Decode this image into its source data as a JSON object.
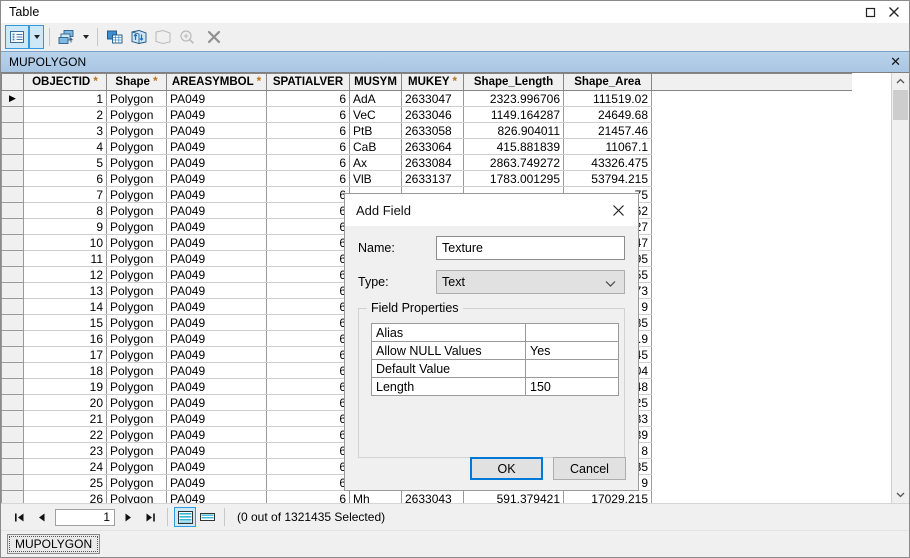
{
  "window": {
    "title": "Table",
    "restore_icon": "restore-window-icon",
    "close_icon": "close-window-icon"
  },
  "toolbar": {
    "items": [
      {
        "name": "table-options-button",
        "icon": "table-options-icon"
      },
      {
        "name": "table-options-dropdown",
        "icon": "chevron-down-icon"
      },
      {
        "name": "related-tables-button",
        "icon": "related-tables-icon"
      },
      {
        "name": "related-tables-dropdown",
        "icon": "chevron-down-icon"
      },
      {
        "name": "select-by-attributes-button",
        "icon": "select-by-attributes-icon"
      },
      {
        "name": "switch-selection-button",
        "icon": "switch-selection-icon"
      },
      {
        "name": "zoom-to-selected-button",
        "icon": "zoom-to-selected-icon"
      },
      {
        "name": "zoom-to-selection-button",
        "icon": "magnifier-plus-icon"
      },
      {
        "name": "clear-selection-button",
        "icon": "clear-selection-x-icon"
      }
    ]
  },
  "tabstrip": {
    "label": "MUPOLYGON",
    "close_icon": "close-tab-icon"
  },
  "table": {
    "columns": [
      {
        "label": "OBJECTID",
        "required": true,
        "align": "num",
        "cls": "col-oid"
      },
      {
        "label": "Shape",
        "required": true,
        "align": "txt",
        "cls": "col-shape"
      },
      {
        "label": "AREASYMBOL",
        "required": true,
        "align": "txt",
        "cls": "col-area"
      },
      {
        "label": "SPATIALVER",
        "required": false,
        "align": "num",
        "cls": "col-spat"
      },
      {
        "label": "MUSYM",
        "required": false,
        "align": "txt",
        "cls": "col-musym"
      },
      {
        "label": "MUKEY",
        "required": true,
        "align": "txt",
        "cls": "col-mukey"
      },
      {
        "label": "Shape_Length",
        "required": false,
        "align": "num",
        "cls": "col-len"
      },
      {
        "label": "Shape_Area",
        "required": false,
        "align": "num",
        "cls": "col-sarea"
      }
    ],
    "rows": [
      [
        "1",
        "Polygon",
        "PA049",
        "6",
        "AdA",
        "2633047",
        "2323.996706",
        "111519.02"
      ],
      [
        "2",
        "Polygon",
        "PA049",
        "6",
        "VeC",
        "2633046",
        "1149.164287",
        "24649.68"
      ],
      [
        "3",
        "Polygon",
        "PA049",
        "6",
        "PtB",
        "2633058",
        "826.904011",
        "21457.46"
      ],
      [
        "4",
        "Polygon",
        "PA049",
        "6",
        "CaB",
        "2633064",
        "415.881839",
        "11067.1"
      ],
      [
        "5",
        "Polygon",
        "PA049",
        "6",
        "Ax",
        "2633084",
        "2863.749272",
        "43326.475"
      ],
      [
        "6",
        "Polygon",
        "PA049",
        "6",
        "VlB",
        "2633137",
        "1783.001295",
        "53794.215"
      ],
      [
        "7",
        "Polygon",
        "PA049",
        "6",
        "",
        "",
        "",
        "75"
      ],
      [
        "8",
        "Polygon",
        "PA049",
        "6",
        "",
        "",
        "",
        "62"
      ],
      [
        "9",
        "Polygon",
        "PA049",
        "6",
        "",
        "",
        "",
        "27"
      ],
      [
        "10",
        "Polygon",
        "PA049",
        "6",
        "",
        "",
        "",
        "47"
      ],
      [
        "11",
        "Polygon",
        "PA049",
        "6",
        "",
        "",
        "",
        "95"
      ],
      [
        "12",
        "Polygon",
        "PA049",
        "6",
        "",
        "",
        "",
        "55"
      ],
      [
        "13",
        "Polygon",
        "PA049",
        "6",
        "",
        "",
        "",
        "73"
      ],
      [
        "14",
        "Polygon",
        "PA049",
        "6",
        "",
        "",
        "",
        "9"
      ],
      [
        "15",
        "Polygon",
        "PA049",
        "6",
        "",
        "",
        "",
        "85"
      ],
      [
        "16",
        "Polygon",
        "PA049",
        "6",
        "",
        "",
        "",
        ".9"
      ],
      [
        "17",
        "Polygon",
        "PA049",
        "6",
        "",
        "",
        "",
        "45"
      ],
      [
        "18",
        "Polygon",
        "PA049",
        "6",
        "",
        "",
        "",
        "04"
      ],
      [
        "19",
        "Polygon",
        "PA049",
        "6",
        "",
        "",
        "",
        "48"
      ],
      [
        "20",
        "Polygon",
        "PA049",
        "6",
        "",
        "",
        "",
        "25"
      ],
      [
        "21",
        "Polygon",
        "PA049",
        "6",
        "",
        "",
        "",
        "33"
      ],
      [
        "22",
        "Polygon",
        "PA049",
        "6",
        "",
        "",
        "",
        "39"
      ],
      [
        "23",
        "Polygon",
        "PA049",
        "6",
        "",
        "",
        "",
        "8"
      ],
      [
        "24",
        "Polygon",
        "PA049",
        "6",
        "",
        "",
        "",
        "85"
      ],
      [
        "25",
        "Polygon",
        "PA049",
        "6",
        "",
        "",
        "",
        "9"
      ],
      [
        "26",
        "Polygon",
        "PA049",
        "6",
        "Mh",
        "2633043",
        "591.379421",
        "17029.215"
      ]
    ],
    "current_row_marker": "▶"
  },
  "scrollbar": {
    "up_icon": "scroll-up-icon",
    "down_icon": "scroll-down-icon"
  },
  "statusbar": {
    "first_icon": "first-record-icon",
    "prev_icon": "previous-record-icon",
    "record_number": "1",
    "next_icon": "next-record-icon",
    "last_icon": "last-record-icon",
    "show_all_icon": "show-all-records-icon",
    "show_selected_icon": "show-selected-records-icon",
    "selection_text": "(0 out of 1321435 Selected)"
  },
  "bottom_tabs": {
    "active": "MUPOLYGON"
  },
  "dialog": {
    "title": "Add Field",
    "close_icon": "dialog-close-icon",
    "name_label": "Name:",
    "name_value": "Texture",
    "type_label": "Type:",
    "type_value": "Text",
    "type_chevron": "chevron-down-icon",
    "group_label": "Field Properties",
    "properties": [
      {
        "key": "Alias",
        "value": ""
      },
      {
        "key": "Allow NULL Values",
        "value": "Yes"
      },
      {
        "key": "Default Value",
        "value": ""
      },
      {
        "key": "Length",
        "value": "150"
      }
    ],
    "ok_label": "OK",
    "cancel_label": "Cancel"
  },
  "colors": {
    "accent": "#0078d7",
    "tab_blue": "#a8c6e3",
    "required_star": "#c07010"
  }
}
